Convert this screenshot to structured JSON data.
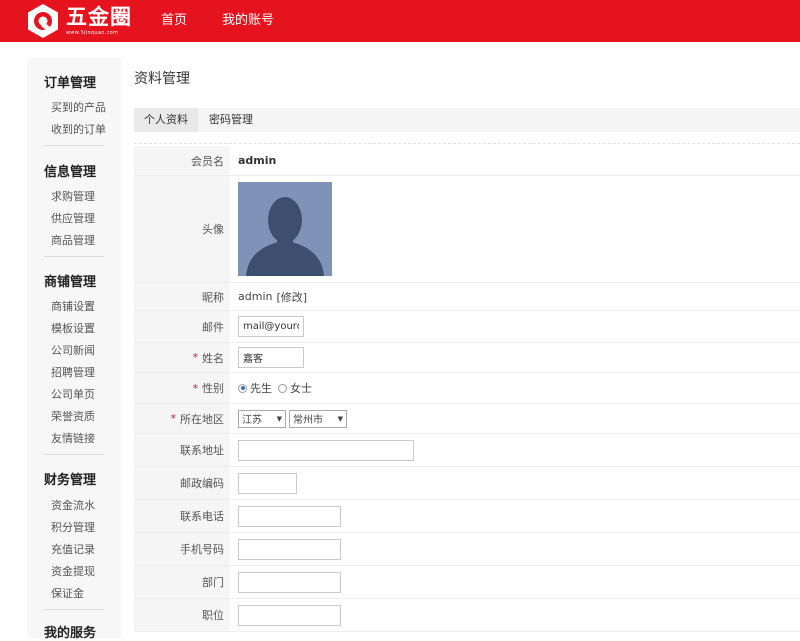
{
  "header": {
    "brand": "五金圈",
    "url": "www.5jinquan.com",
    "nav": [
      "首页",
      "我的账号"
    ],
    "brand_color": "#e5131e"
  },
  "sidebar": {
    "sections": [
      {
        "title": "订单管理",
        "items": [
          "买到的产品",
          "收到的订单"
        ]
      },
      {
        "title": "信息管理",
        "items": [
          "求购管理",
          "供应管理",
          "商品管理"
        ]
      },
      {
        "title": "商铺管理",
        "items": [
          "商铺设置",
          "模板设置",
          "公司新闻",
          "招聘管理",
          "公司单页",
          "荣誉资质",
          "友情链接"
        ]
      },
      {
        "title": "财务管理",
        "items": [
          "资金流水",
          "积分管理",
          "充值记录",
          "资金提现",
          "保证金"
        ]
      },
      {
        "title": "我的服务",
        "items": []
      }
    ]
  },
  "main": {
    "title": "资料管理",
    "tabs": [
      "个人资料",
      "密码管理"
    ],
    "form": {
      "member_label": "会员名",
      "member_value": "admin",
      "avatar_label": "头像",
      "nickname_label": "昵称",
      "nickname_value": "admin",
      "nickname_edit": "[修改]",
      "email_label": "邮件",
      "email_value": "mail@yourdomain.com",
      "name_label": "姓名",
      "name_value": "嘉客",
      "gender_label": "性别",
      "gender_male": "先生",
      "gender_female": "女士",
      "gender_selected": "先生",
      "region_label": "所在地区",
      "province": "江苏",
      "city": "常州市",
      "address_label": "联系地址",
      "address_value": "",
      "postcode_label": "邮政编码",
      "postcode_value": "",
      "phone_label": "联系电话",
      "phone_value": "",
      "mobile_label": "手机号码",
      "mobile_value": "",
      "dept_label": "部门",
      "dept_value": "",
      "position_label": "职位",
      "position_value": "",
      "required_mark": "*"
    }
  }
}
